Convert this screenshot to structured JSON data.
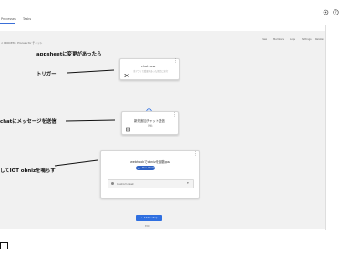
{
  "tabs": [
    "Processes",
    "Tasks"
  ],
  "breadcrumb": "< PROCESS: Process for チャット",
  "toolbar": [
    "View",
    "Members",
    "Logs",
    "Settings",
    "Related"
  ],
  "steps": {
    "trigger": {
      "title": "chat new",
      "subtitle": "当アプリで変更があった場合に実行"
    },
    "chat": {
      "title": "新規追加チャット送信"
    },
    "webhook": {
      "title": "webhookでobnizを起動gas",
      "run_pill": "Run a task",
      "task_select": "Custom task"
    }
  },
  "annotations": {
    "a1": "appsheetに変更があったら",
    "a2": "トリガー",
    "a3": "chatにメッセージを送信",
    "a4": "してIOT obnizを鳴らす"
  },
  "add_step_label": "+ Add a step",
  "end_label": "END",
  "colors": {
    "accent": "#2f6fe0",
    "step_bg": "#ffffff",
    "canvas_bg": "#f1f1f1"
  }
}
